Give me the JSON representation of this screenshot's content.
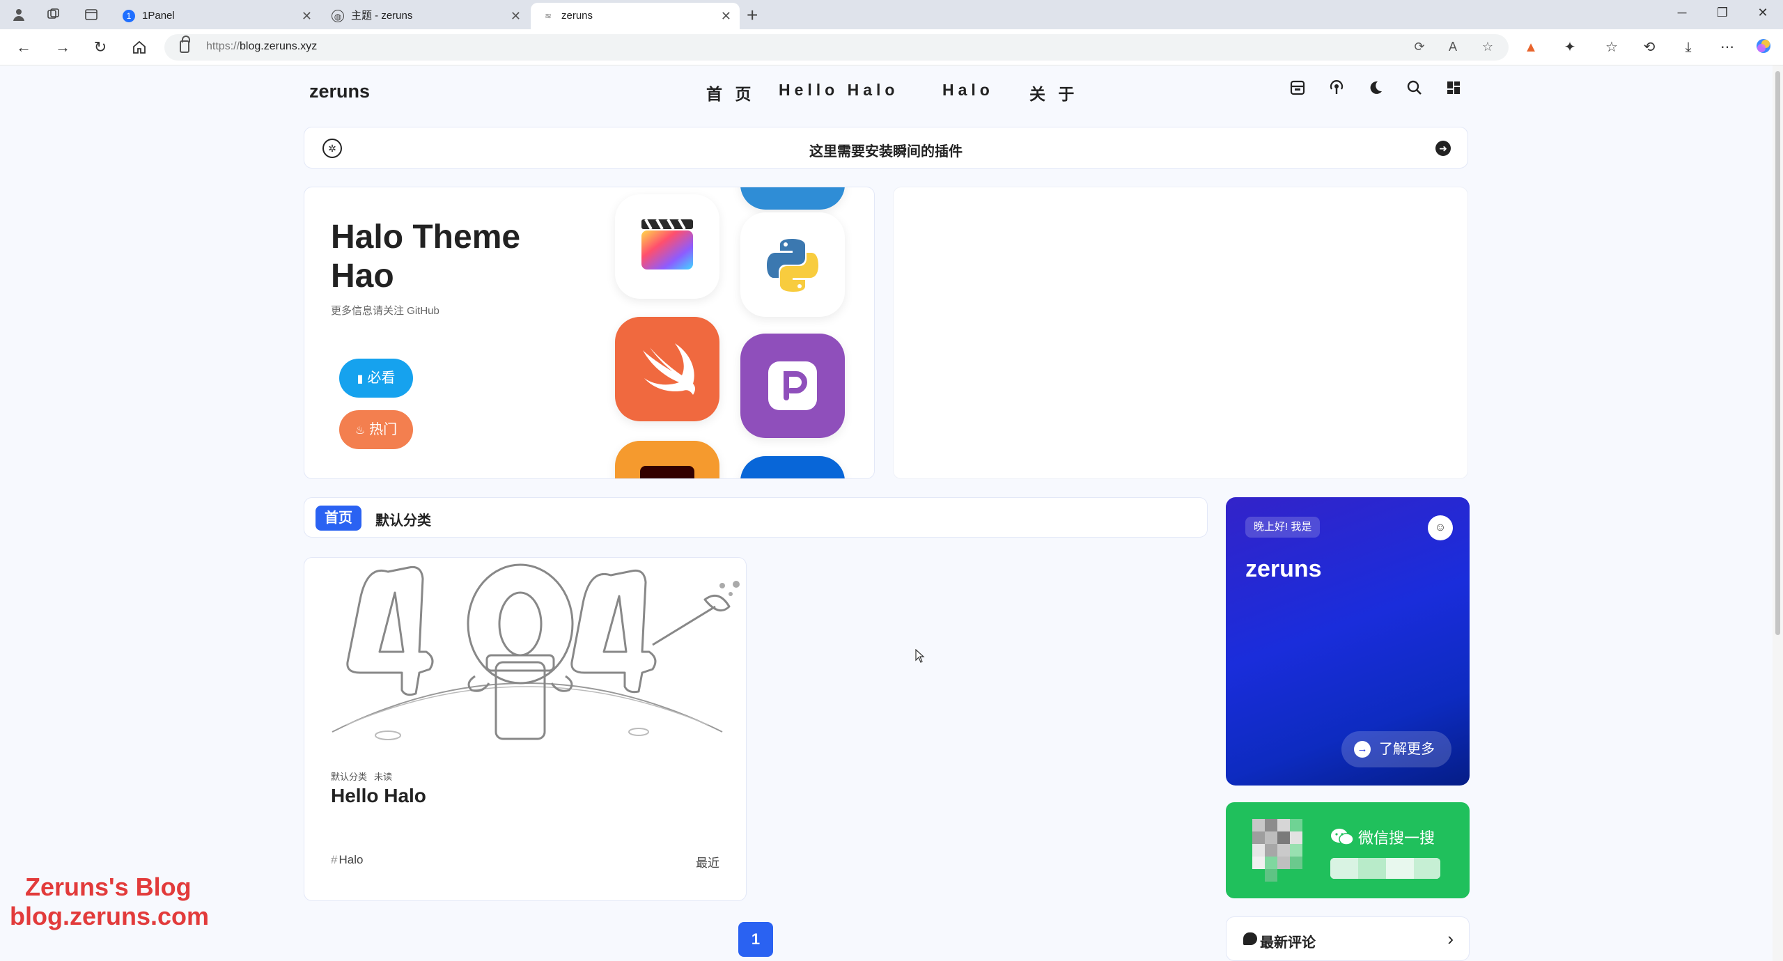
{
  "browser": {
    "tabs": [
      {
        "title": "1Panel",
        "active": false
      },
      {
        "title": "主题 - zeruns",
        "active": false
      },
      {
        "title": "zeruns",
        "active": true
      }
    ],
    "url_protocol": "https://",
    "url_host": "blog.zeruns.xyz",
    "window_controls": {
      "minimize": "─",
      "restore": "❐",
      "close": "✕"
    }
  },
  "site": {
    "logo": "zeruns",
    "menu": [
      "首 页",
      "Hello Halo",
      "Halo",
      "关 于"
    ],
    "header_icons": [
      "archive-icon",
      "podcast-icon",
      "dark-mode-icon",
      "search-icon",
      "grid-menu-icon"
    ]
  },
  "notice": {
    "text": "这里需要安装瞬间的插件"
  },
  "hero": {
    "title": "Halo Theme Hao",
    "subtitle": "更多信息请关注 GitHub",
    "buttons": [
      {
        "label": "必看",
        "icon": "book-icon",
        "color": "#16a2ee"
      },
      {
        "label": "热门",
        "icon": "fire-icon",
        "color": "#f37f4f"
      }
    ]
  },
  "categories": {
    "active": "首页",
    "items": [
      "默认分类"
    ]
  },
  "post": {
    "meta": [
      "默认分类",
      "未读"
    ],
    "title": "Hello Halo",
    "tag": "Halo",
    "tag_prefix": "#",
    "date": "最近",
    "cover_text": "404"
  },
  "pagination": {
    "current": "1"
  },
  "profile": {
    "greeting": "晚上好! 我是",
    "name": "zeruns",
    "more_label": "了解更多",
    "gradient": [
      "#3323c9",
      "#051d86"
    ]
  },
  "wechat": {
    "label": "微信搜一搜",
    "color": "#20c05c"
  },
  "comments": {
    "title": "最新评论"
  },
  "watermark": {
    "line1": "Zeruns's Blog",
    "line2": "blog.zeruns.com",
    "color": "#e23b3b"
  },
  "colors": {
    "accent": "#2a62f2",
    "page_bg": "#f7f9fe"
  }
}
